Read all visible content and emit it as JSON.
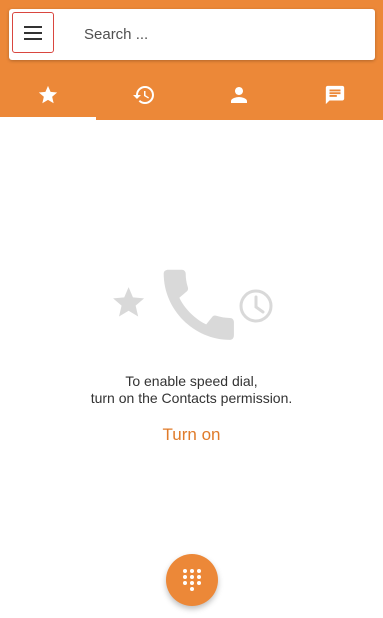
{
  "search": {
    "placeholder": "Search ..."
  },
  "tabs": [
    {
      "icon": "star-icon",
      "active": true
    },
    {
      "icon": "history-icon",
      "active": false
    },
    {
      "icon": "person-icon",
      "active": false
    },
    {
      "icon": "message-icon",
      "active": false
    }
  ],
  "empty_state": {
    "line1": "To enable speed dial,",
    "line2": "turn on the Contacts permission.",
    "action_label": "Turn on"
  },
  "fab": {
    "icon": "dialpad-icon"
  },
  "colors": {
    "accent": "#ec8838",
    "action_text": "#e07b2a",
    "illustration": "#d9d9d9"
  }
}
